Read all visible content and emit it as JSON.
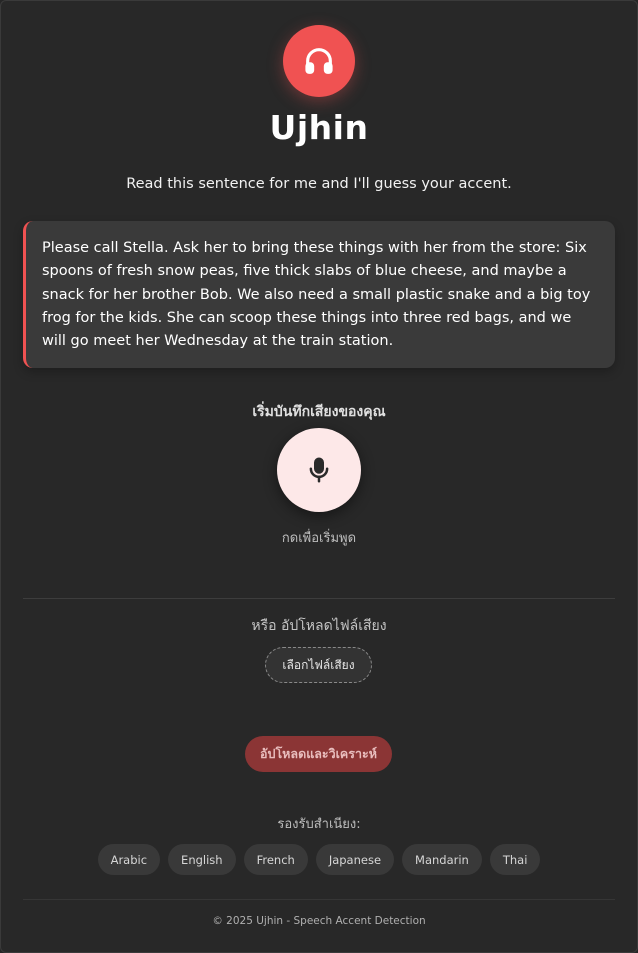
{
  "app": {
    "name": "Ujhin",
    "subtitle": "Read this sentence for me and I'll guess your accent.",
    "accent_color": "#f05252",
    "logo_icon": "headphones-icon"
  },
  "sentence": {
    "text": "Please call Stella. Ask her to bring these things with her from the store: Six spoons of fresh snow peas, five thick slabs of blue cheese, and maybe a snack for her brother Bob. We also need a small plastic snake and a big toy frog for the kids. She can scoop these things into three red bags, and we will go meet her Wednesday at the train station."
  },
  "recording": {
    "title": "เริ่มบันทึกเสียงของคุณ",
    "mic_icon": "microphone-icon",
    "hint": "กดเพื่อเริ่มพูด"
  },
  "upload": {
    "title": "หรือ อัปโหลดไฟล์เสียง",
    "choose_file_label": "เลือกไฟล์เสียง",
    "analyze_label": "อัปโหลดและวิเคราะห์"
  },
  "supported": {
    "title": "รองรับสำเนียง:",
    "accents": [
      "Arabic",
      "English",
      "French",
      "Japanese",
      "Mandarin",
      "Thai"
    ]
  },
  "footer": {
    "text": "© 2025 Ujhin - Speech Accent Detection"
  }
}
